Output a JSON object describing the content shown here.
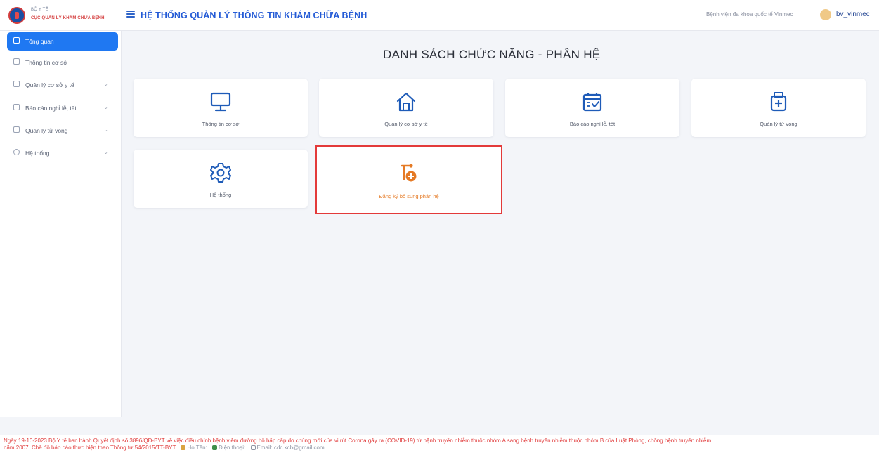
{
  "header": {
    "org_line1": "BỘ Y TẾ",
    "org_line2": "CỤC QUẢN LÝ KHÁM CHỮA BỆNH",
    "app_title": "HỆ THỐNG QUẢN LÝ THÔNG TIN KHÁM CHỮA BỆNH",
    "hospital": "Bệnh viện đa khoa quốc tế Vinmec",
    "username": "bv_vinmec"
  },
  "sidebar": {
    "items": [
      {
        "label": "Tổng quan",
        "icon": "dashboard-icon",
        "active": true
      },
      {
        "label": "Thông tin cơ sở",
        "icon": "monitor-icon",
        "has_children": false
      },
      {
        "label": "Quản lý cơ sở y tế",
        "icon": "home-icon",
        "has_children": true
      },
      {
        "label": "Báo cáo nghỉ lễ, tết",
        "icon": "calendar-icon",
        "has_children": true
      },
      {
        "label": "Quản lý tử vong",
        "icon": "medical-box-icon",
        "has_children": true
      },
      {
        "label": "Hệ thống",
        "icon": "gear-icon",
        "has_children": true
      }
    ]
  },
  "main": {
    "heading": "DANH SÁCH CHỨC NĂNG - PHÂN HỆ",
    "cards": [
      {
        "label": "Thông tin cơ sở",
        "icon": "monitor-icon"
      },
      {
        "label": "Quản lý cơ sở y tế",
        "icon": "home-icon"
      },
      {
        "label": "Báo cáo nghỉ lễ, tết",
        "icon": "calendar-check-icon"
      },
      {
        "label": "Quản lý tử vong",
        "icon": "medical-box-icon"
      },
      {
        "label": "Hệ thống",
        "icon": "gear-icon"
      },
      {
        "label": "Đăng ký bổ sung phân hệ",
        "icon": "add-module-icon",
        "highlighted": true
      }
    ]
  },
  "footer": {
    "notice_line1": "Ngày 19-10-2023 Bộ Y tế ban hành Quyết định số 3896/QĐ-BYT về việc điều chỉnh bệnh viêm đường hô hấp cấp do chủng mới của vi rút Corona gây ra (COVID-19) từ bệnh truyền nhiễm thuộc nhóm A sang bệnh truyền nhiễm thuộc nhóm B của Luật Phòng, chống bệnh truyền nhiễm",
    "notice_line2": "năm 2007. Chế độ báo cáo thực hiện theo Thông tư 54/2015/TT-BYT",
    "contact_name": "Họ Tên:",
    "contact_phone": "Điện thoại:",
    "contact_email": "Email: cdc.kcb@gmail.com"
  },
  "colors": {
    "primary": "#1f78f2",
    "title_blue": "#245bd6",
    "icon_blue": "#1e5bb8",
    "alert_red": "#e03a3a",
    "highlight_orange": "#e57a25"
  }
}
